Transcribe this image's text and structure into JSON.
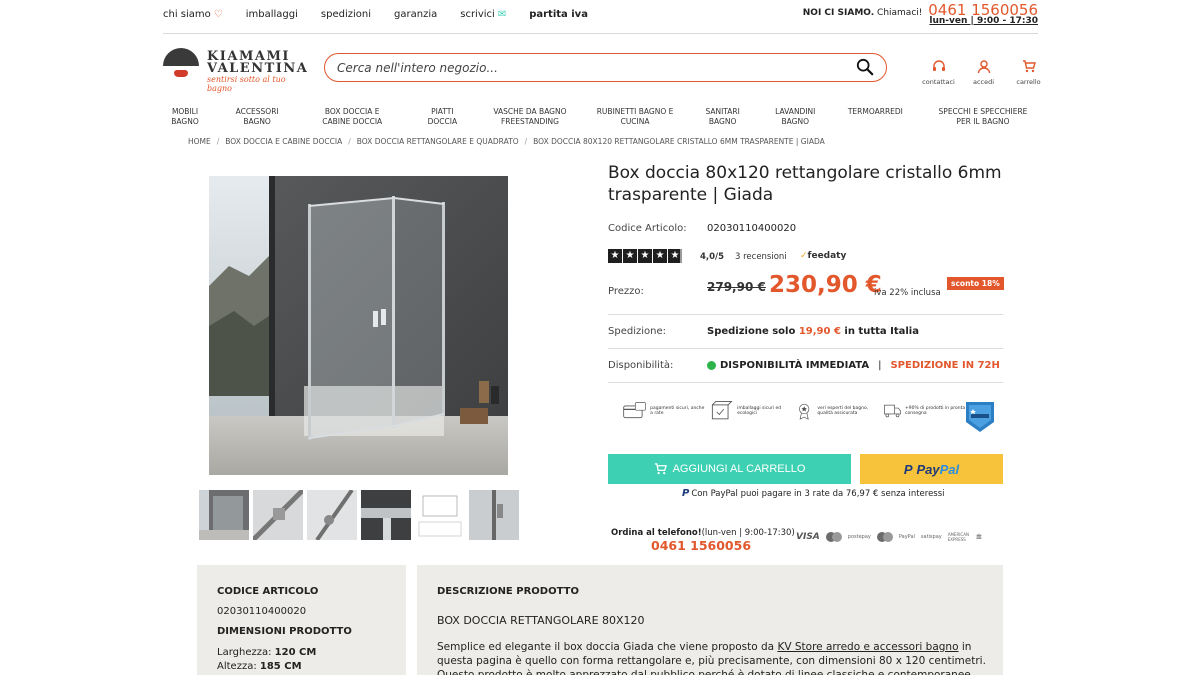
{
  "topbar": {
    "links": [
      {
        "label": "chi siamo",
        "icon": "heart-icon"
      },
      {
        "label": "imballaggi"
      },
      {
        "label": "spedizioni"
      },
      {
        "label": "garanzia"
      },
      {
        "label": "scrivici",
        "icon": "mail-icon"
      },
      {
        "label": "partita iva"
      }
    ],
    "contact_prefix": "NOI CI SIAMO.",
    "contact_call": "Chiamaci!",
    "contact_phone": "0461 1560056",
    "contact_hours": "lun-ven | 9:00 - 17:30"
  },
  "logo": {
    "line1": "KIAMAMI",
    "line2": "VALENTINA",
    "tagline": "sentirsi sotto al tuo bagno"
  },
  "search": {
    "placeholder": "Cerca nell'intero negozio..."
  },
  "header_icons": [
    {
      "label": "contattaci",
      "icon": "headset-icon"
    },
    {
      "label": "accedi",
      "icon": "user-icon"
    },
    {
      "label": "carrello",
      "icon": "cart-icon"
    }
  ],
  "nav": [
    "MOBILI BAGNO",
    "ACCESSORI BAGNO",
    "BOX DOCCIA E CABINE DOCCIA",
    "PIATTI DOCCIA",
    "VASCHE DA BAGNO FREESTANDING",
    "RUBINETTI BAGNO E CUCINA",
    "SANITARI BAGNO",
    "LAVANDINI BAGNO",
    "TERMOARREDI",
    "SPECCHI E SPECCHIERE PER IL BAGNO"
  ],
  "breadcrumb": [
    "HOME",
    "BOX DOCCIA E CABINE DOCCIA",
    "BOX DOCCIA RETTANGOLARE E QUADRATO",
    "BOX DOCCIA 80X120 RETTANGOLARE CRISTALLO 6MM TRASPARENTE | GIADA"
  ],
  "product": {
    "title": "Box doccia 80x120 rettangolare cristallo 6mm trasparente | Giada",
    "code_label": "Codice Articolo:",
    "code": "02030110400020",
    "rating": "4,0/5",
    "stars": 4,
    "reviews": "3 recensioni",
    "review_brand": "feedaty",
    "price_label": "Prezzo:",
    "old_price": "279,90 €",
    "price": "230,90 €",
    "vat": "iva 22% inclusa",
    "discount": "sconto 18%",
    "shipping_label": "Spedizione:",
    "shipping_text_before": "Spedizione solo",
    "shipping_price": "19,90 €",
    "shipping_text_after": "in tutta Italia",
    "availability_label": "Disponibilità:",
    "availability": "DISPONIBILITÀ IMMEDIATA",
    "availability_sep": "|",
    "dispatch": "SPEDIZIONE IN 72H",
    "add_to_cart": "AGGIUNGI AL CARRELLO",
    "paypal_1": "Pay",
    "paypal_2": "Pal",
    "paypal_note": "Con PayPal puoi pagare in 3 rate da 76,97 € senza interessi",
    "order_phone_label": "Ordina al telefono!",
    "order_phone_hours": "(lun-ven | 9:00-17:30)",
    "order_phone": "0461 1560056"
  },
  "badges": [
    {
      "text": "pagamenti sicuri, anche a rate",
      "icon": "card-icon"
    },
    {
      "text": "imballaggi sicuri ed ecologici",
      "icon": "box-icon"
    },
    {
      "text": "veri esperti del bagno, qualità assicurata",
      "icon": "award-icon"
    },
    {
      "text": "+90% di prodotti in pronta consegna",
      "icon": "truck-icon"
    }
  ],
  "payments": [
    "VISA",
    "mastercard",
    "postepay",
    "maestro",
    "PayPal",
    "satispay",
    "AMERICAN EXPRESS",
    "bonifico"
  ],
  "details": {
    "code_heading": "CODICE ARTICOLO",
    "code": "02030110400020",
    "dims_heading": "DIMENSIONI PRODOTTO",
    "width_label": "Larghezza:",
    "width": "120 CM",
    "height_label": "Altezza:",
    "height": "185 CM"
  },
  "description": {
    "heading": "DESCRIZIONE PRODOTTO",
    "subheading": "BOX DOCCIA RETTANGOLARE 80X120",
    "body_before": "Semplice ed elegante il box doccia Giada che viene proposto da ",
    "body_link": "KV Store arredo e accessori bagno",
    "body_after": " in questa pagina è quello con forma rettangolare e, più precisamente, con dimensioni 80 x 120 centimetri. Questo prodotto è molto apprezzato dal pubblico perché è dotato di linee classiche e contemporanee permettendone il facile inserimento in"
  },
  "colors": {
    "accent": "#e2572c",
    "cart_button": "#3ed0b3",
    "paypal_button": "#f7c33b",
    "panel": "#eeece8",
    "available": "#2cb34a"
  }
}
